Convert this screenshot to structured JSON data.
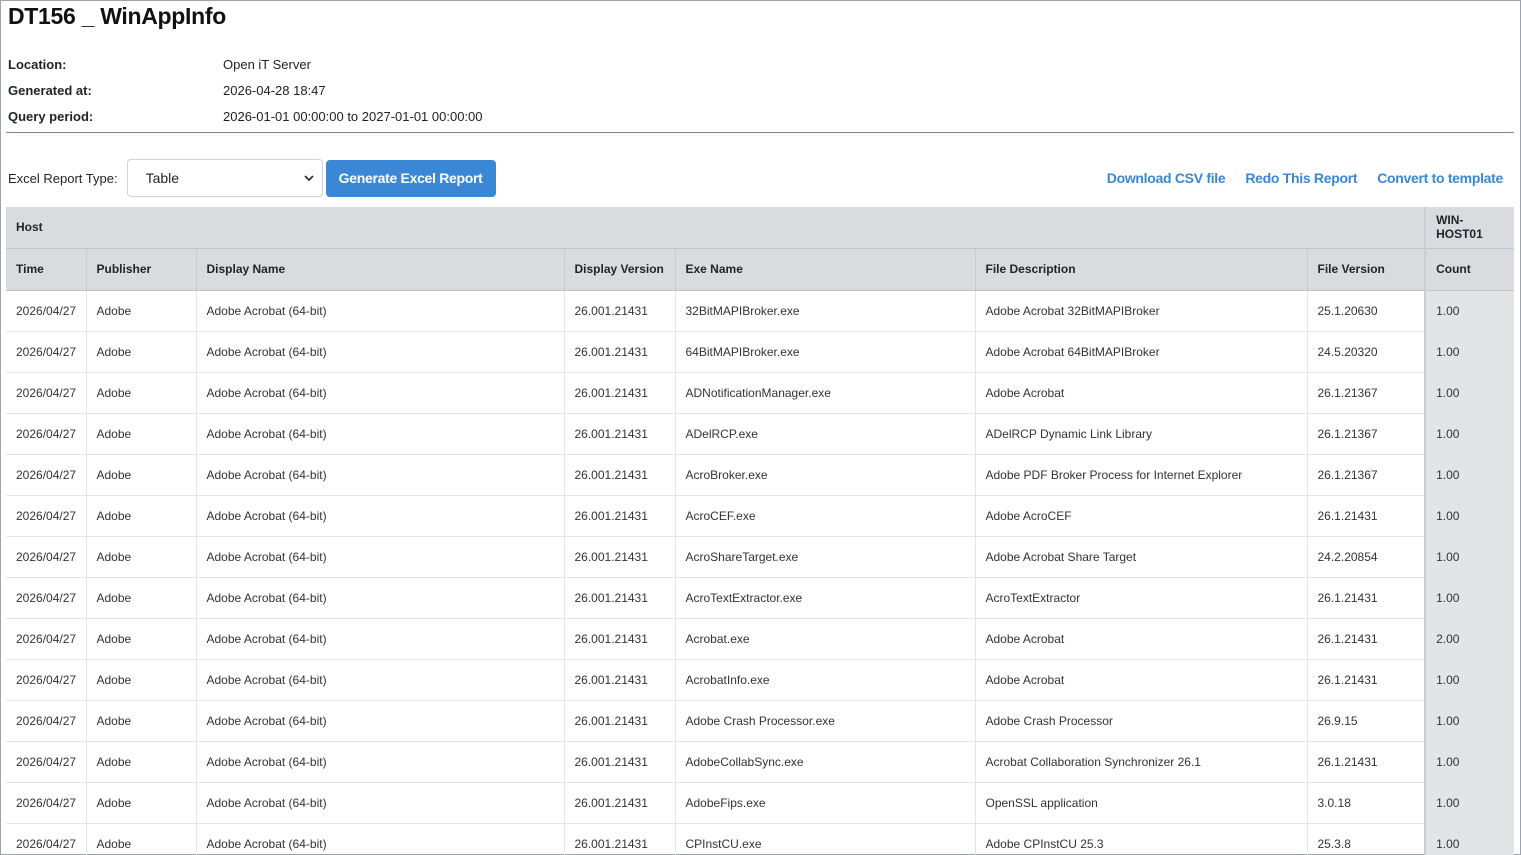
{
  "page_title": "DT156 _ WinAppInfo",
  "meta": [
    {
      "label": "Location:",
      "value": "Open iT Server"
    },
    {
      "label": "Generated at:",
      "value": "2026-04-28 18:47"
    },
    {
      "label": "Query period:",
      "value": "2026-01-01 00:00:00 to 2027-01-01 00:00:00"
    }
  ],
  "toolbar": {
    "report_type_label": "Excel Report Type:",
    "report_type_selected": "Table",
    "generate_label": "Generate Excel Report",
    "download_csv": "Download CSV file",
    "redo_report": "Redo This Report",
    "convert_template": "Convert to template"
  },
  "table": {
    "host_header": "Host",
    "host_value": "WIN-HOST01",
    "columns": [
      "Time",
      "Publisher",
      "Display Name",
      "Display Version",
      "Exe Name",
      "File Description",
      "File Version",
      "Count"
    ],
    "rows": [
      [
        "2026/04/27",
        "Adobe",
        "Adobe Acrobat (64-bit)",
        "26.001.21431",
        "32BitMAPIBroker.exe",
        "Adobe Acrobat 32BitMAPIBroker",
        "25.1.20630",
        "1.00"
      ],
      [
        "2026/04/27",
        "Adobe",
        "Adobe Acrobat (64-bit)",
        "26.001.21431",
        "64BitMAPIBroker.exe",
        "Adobe Acrobat 64BitMAPIBroker",
        "24.5.20320",
        "1.00"
      ],
      [
        "2026/04/27",
        "Adobe",
        "Adobe Acrobat (64-bit)",
        "26.001.21431",
        "ADNotificationManager.exe",
        "Adobe Acrobat",
        "26.1.21367",
        "1.00"
      ],
      [
        "2026/04/27",
        "Adobe",
        "Adobe Acrobat (64-bit)",
        "26.001.21431",
        "ADelRCP.exe",
        "ADelRCP Dynamic Link Library",
        "26.1.21367",
        "1.00"
      ],
      [
        "2026/04/27",
        "Adobe",
        "Adobe Acrobat (64-bit)",
        "26.001.21431",
        "AcroBroker.exe",
        "Adobe PDF Broker Process for Internet Explorer",
        "26.1.21367",
        "1.00"
      ],
      [
        "2026/04/27",
        "Adobe",
        "Adobe Acrobat (64-bit)",
        "26.001.21431",
        "AcroCEF.exe",
        "Adobe AcroCEF",
        "26.1.21431",
        "1.00"
      ],
      [
        "2026/04/27",
        "Adobe",
        "Adobe Acrobat (64-bit)",
        "26.001.21431",
        "AcroShareTarget.exe",
        "Adobe Acrobat Share Target",
        "24.2.20854",
        "1.00"
      ],
      [
        "2026/04/27",
        "Adobe",
        "Adobe Acrobat (64-bit)",
        "26.001.21431",
        "AcroTextExtractor.exe",
        "AcroTextExtractor",
        "26.1.21431",
        "1.00"
      ],
      [
        "2026/04/27",
        "Adobe",
        "Adobe Acrobat (64-bit)",
        "26.001.21431",
        "Acrobat.exe",
        "Adobe Acrobat",
        "26.1.21431",
        "2.00"
      ],
      [
        "2026/04/27",
        "Adobe",
        "Adobe Acrobat (64-bit)",
        "26.001.21431",
        "AcrobatInfo.exe",
        "Adobe Acrobat",
        "26.1.21431",
        "1.00"
      ],
      [
        "2026/04/27",
        "Adobe",
        "Adobe Acrobat (64-bit)",
        "26.001.21431",
        "Adobe Crash Processor.exe",
        "Adobe Crash Processor",
        "26.9.15",
        "1.00"
      ],
      [
        "2026/04/27",
        "Adobe",
        "Adobe Acrobat (64-bit)",
        "26.001.21431",
        "AdobeCollabSync.exe",
        "Acrobat Collaboration Synchronizer 26.1",
        "26.1.21431",
        "1.00"
      ],
      [
        "2026/04/27",
        "Adobe",
        "Adobe Acrobat (64-bit)",
        "26.001.21431",
        "AdobeFips.exe",
        "OpenSSL application",
        "3.0.18",
        "1.00"
      ],
      [
        "2026/04/27",
        "Adobe",
        "Adobe Acrobat (64-bit)",
        "26.001.21431",
        "CPInstCU.exe",
        "Adobe CPInstCU 25.3",
        "25.3.8",
        "1.00"
      ]
    ]
  },
  "colors": {
    "accent": "#3a87d6",
    "header_bg": "#d9dcdf"
  },
  "icons": {
    "select_arrow": "chevron-down-icon"
  }
}
